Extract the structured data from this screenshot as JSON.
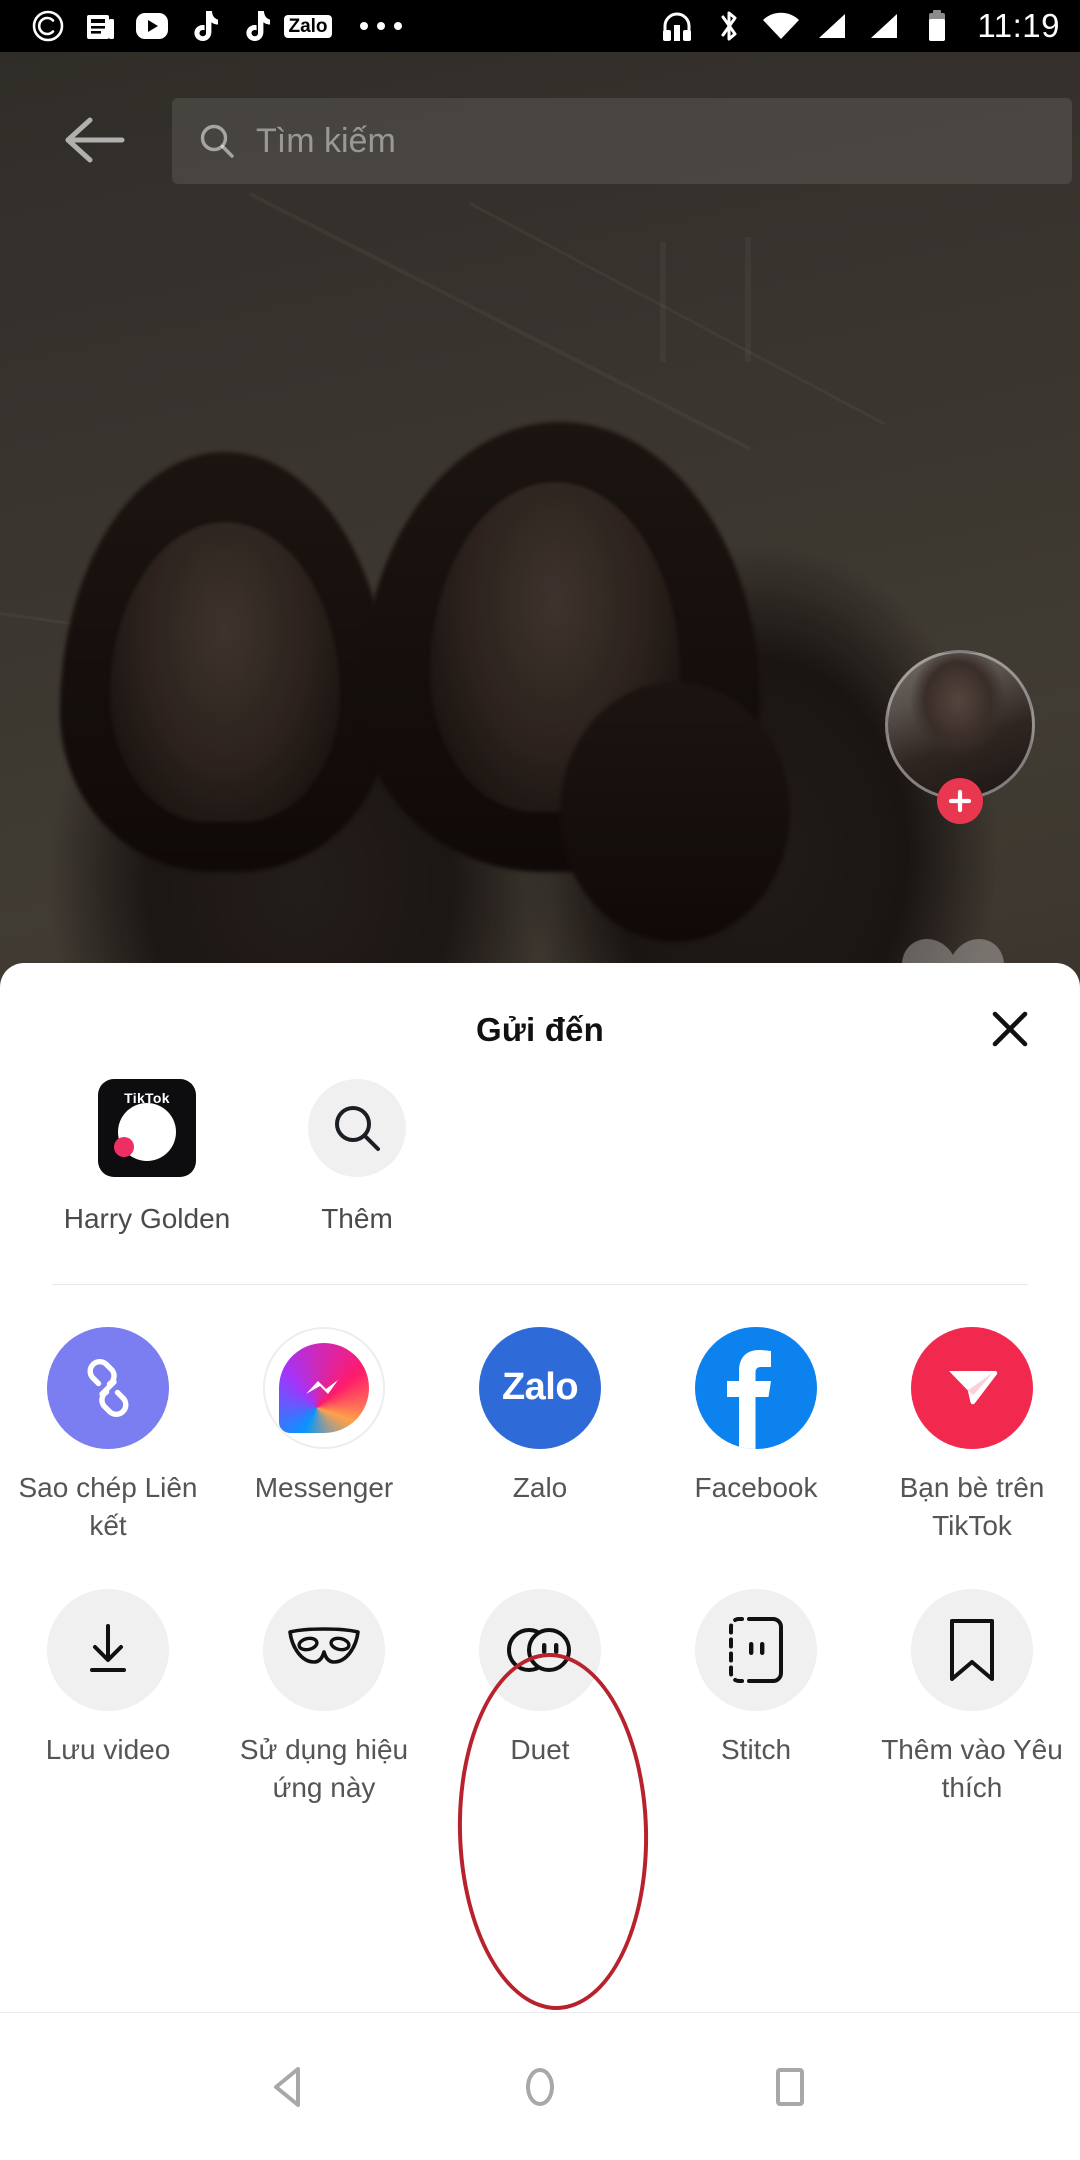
{
  "status_bar": {
    "time": "11:19",
    "left_icons": [
      "copyright-icon",
      "news-icon",
      "youtube-icon",
      "tiktok-icon",
      "tiktok-icon-2",
      "zalo-icon"
    ],
    "zalo_label": "Zalo",
    "overflow": "more-notifications-icon",
    "right_icons": [
      "headphones-icon",
      "bluetooth-icon",
      "wifi-icon",
      "signal-icon-1",
      "signal-icon-2",
      "battery-icon"
    ]
  },
  "video_screen": {
    "back_icon": "back-arrow-icon",
    "search": {
      "placeholder": "Tìm kiếm",
      "icon": "search-icon"
    },
    "author": {
      "avatar": "author-avatar",
      "follow_icon": "plus-icon"
    },
    "like_icon": "heart-icon"
  },
  "share_sheet": {
    "title": "Gửi đến",
    "close_icon": "close-icon",
    "contacts": [
      {
        "label": "Harry Golden",
        "icon": "tiktok-app-avatar",
        "wordmark": "TikTok"
      },
      {
        "label": "Thêm",
        "icon": "search-icon"
      }
    ],
    "apps_row_1": [
      {
        "label": "Sao chép Liên kết",
        "icon": "link-icon",
        "color": "#7b7ef0"
      },
      {
        "label": "Messenger",
        "icon": "messenger-icon",
        "color": "#ffffff"
      },
      {
        "label": "Zalo",
        "icon": "zalo-icon",
        "text": "Zalo",
        "color": "#2f6bd8"
      },
      {
        "label": "Facebook",
        "icon": "facebook-icon",
        "color": "#0c82ee"
      },
      {
        "label": "Bạn bè trên TikTok",
        "icon": "send-plane-icon",
        "color": "#f2294e"
      }
    ],
    "apps_row_2": [
      {
        "label": "Lưu video",
        "icon": "download-icon",
        "color": "#f0f0f0"
      },
      {
        "label": "Sử dụng hiệu ứng này",
        "icon": "mask-icon",
        "color": "#f0f0f0"
      },
      {
        "label": "Duet",
        "icon": "duet-icon",
        "color": "#f0f0f0",
        "highlighted": true
      },
      {
        "label": "Stitch",
        "icon": "stitch-icon",
        "color": "#f0f0f0"
      },
      {
        "label": "Thêm vào Yêu thích",
        "icon": "bookmark-icon",
        "color": "#f0f0f0"
      }
    ]
  },
  "annotation": {
    "shape": "ellipse",
    "color": "#b8222c",
    "targets": "Duet"
  },
  "nav_bar": {
    "back": "nav-back-icon",
    "home": "nav-home-icon",
    "recents": "nav-recents-icon"
  }
}
